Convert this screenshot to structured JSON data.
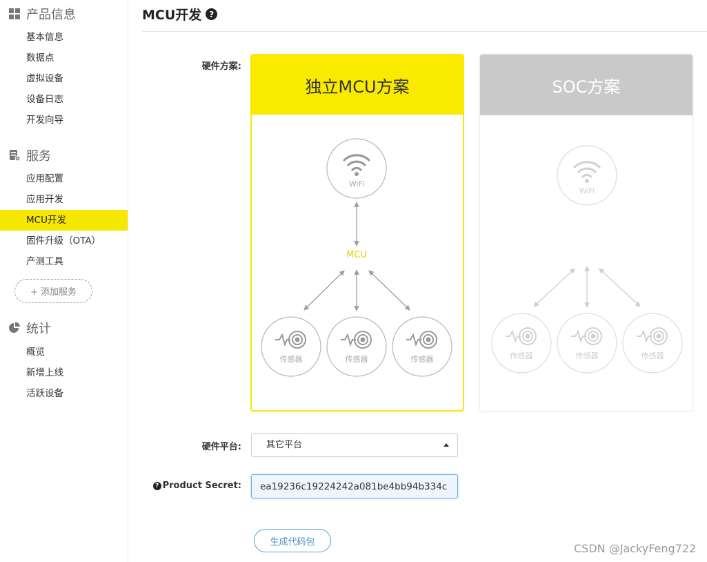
{
  "sidebar": {
    "sections": [
      {
        "title": "产品信息",
        "icon": "grid-icon",
        "items": [
          "基本信息",
          "数据点",
          "虚拟设备",
          "设备日志",
          "开发向导"
        ]
      },
      {
        "title": "服务",
        "icon": "server-settings-icon",
        "items": [
          "应用配置",
          "应用开发",
          "MCU开发",
          "固件升级（OTA）",
          "产测工具"
        ]
      },
      {
        "title": "统计",
        "icon": "pie-chart-icon",
        "items": [
          "概览",
          "新增上线",
          "活跃设备"
        ]
      }
    ],
    "active_item": "MCU开发",
    "add_service_label": "+ 添加服务"
  },
  "page": {
    "title": "MCU开发",
    "help_icon": "?"
  },
  "hardware_scheme": {
    "label": "硬件方案:",
    "options": [
      {
        "title": "独立MCU方案",
        "selected": true,
        "wifi_label": "WiFi",
        "mcu_label": "MCU",
        "sensor_label": "传感器",
        "sensor_count": 3
      },
      {
        "title": "SOC方案",
        "selected": false,
        "wifi_label": "WiFi",
        "sensor_label": "传感器",
        "sensor_count": 3
      }
    ]
  },
  "hardware_platform": {
    "label": "硬件平台:",
    "selected": "其它平台"
  },
  "product_secret": {
    "label": "Product Secret:",
    "value": "ea19236c19224242a081be4bb94b334c"
  },
  "generate_button": "生成代码包",
  "watermark": "CSDN @JackyFeng722",
  "colors": {
    "accent_yellow": "#f9ea00",
    "soc_header": "#c9c9c9",
    "button_blue": "#4aa3d6",
    "icon_gray": "#9e9e9e",
    "icon_light_gray": "#d6d6d6"
  }
}
